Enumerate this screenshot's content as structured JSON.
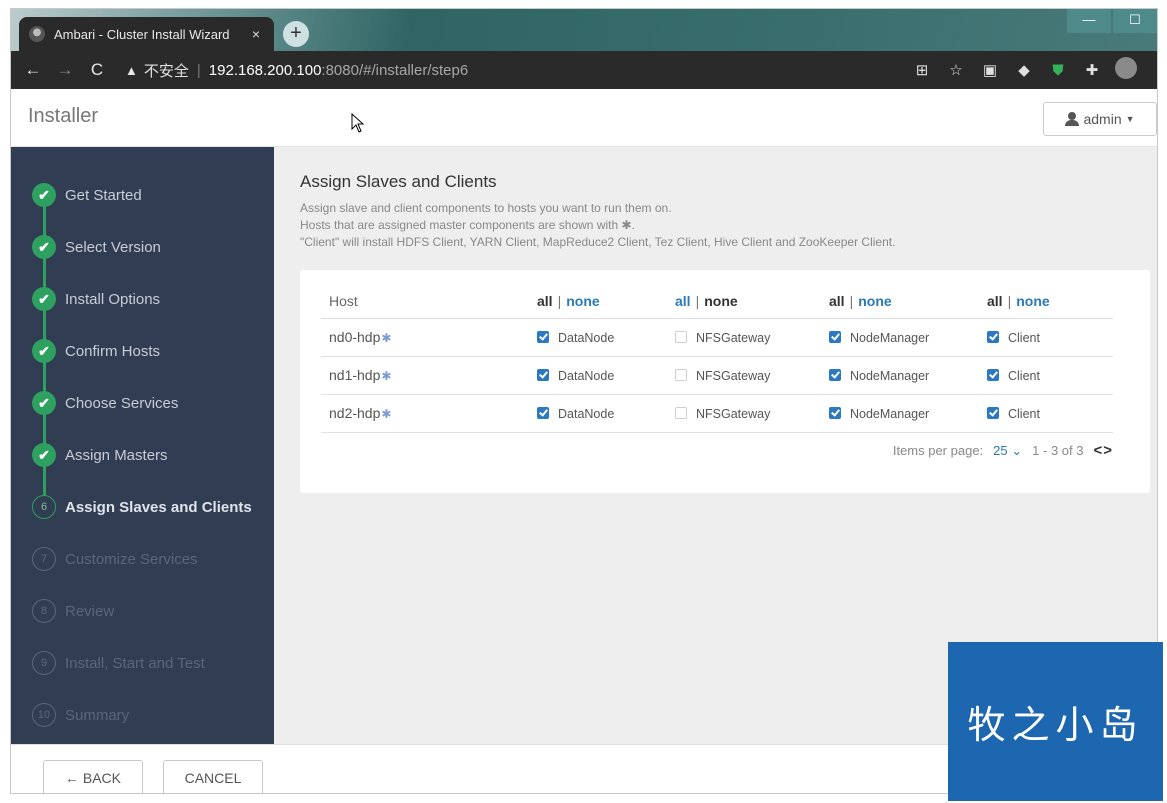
{
  "browser": {
    "tab_title": "Ambari - Cluster Install Wizard",
    "tab_close": "×",
    "new_tab": "+",
    "window_controls": [
      "—",
      "☐"
    ],
    "back": "←",
    "forward": "→",
    "reload": "C",
    "warning_icon": "▲",
    "security_label": "不安全",
    "separator": "|",
    "url_host": "192.168.200.100",
    "url_path": ":8080/#/installer/step6",
    "extension_icons": [
      "translate-icon",
      "star-icon",
      "media-icon",
      "extension-a-icon",
      "shield-icon",
      "puzzle-icon",
      "profile-icon"
    ]
  },
  "header": {
    "brand": "Installer",
    "user": "admin"
  },
  "sidebar": {
    "steps": [
      {
        "label": "Get Started",
        "state": "done",
        "num": "✔"
      },
      {
        "label": "Select Version",
        "state": "done",
        "num": "✔"
      },
      {
        "label": "Install Options",
        "state": "done",
        "num": "✔"
      },
      {
        "label": "Confirm Hosts",
        "state": "done",
        "num": "✔"
      },
      {
        "label": "Choose Services",
        "state": "done",
        "num": "✔"
      },
      {
        "label": "Assign Masters",
        "state": "done",
        "num": "✔"
      },
      {
        "label": "Assign Slaves and Clients",
        "state": "current",
        "num": "6"
      },
      {
        "label": "Customize Services",
        "state": "todo",
        "num": "7"
      },
      {
        "label": "Review",
        "state": "todo",
        "num": "8"
      },
      {
        "label": "Install, Start and Test",
        "state": "todo",
        "num": "9"
      },
      {
        "label": "Summary",
        "state": "todo",
        "num": "10"
      }
    ]
  },
  "main": {
    "title": "Assign Slaves and Clients",
    "desc1": "Assign slave and client components to hosts you want to run them on.",
    "desc2": "Hosts that are assigned master components are shown with ✱.",
    "desc3": "\"Client\" will install HDFS Client, YARN Client, MapReduce2 Client, Tez Client, Hive Client and ZooKeeper Client.",
    "table": {
      "host_header": "Host",
      "all": "all",
      "none": "none",
      "pipe": "|",
      "rows": [
        {
          "host": "nd0-hdp",
          "datanode": true,
          "nfs": false,
          "nm": true,
          "client": true
        },
        {
          "host": "nd1-hdp",
          "datanode": true,
          "nfs": false,
          "nm": true,
          "client": true
        },
        {
          "host": "nd2-hdp",
          "datanode": true,
          "nfs": false,
          "nm": true,
          "client": true
        }
      ],
      "components": [
        "DataNode",
        "NFSGateway",
        "NodeManager",
        "Client"
      ],
      "star": "✱"
    },
    "pager": {
      "label": "Items per page:",
      "per_page": "25",
      "chevron": "⌄",
      "range": "1 - 3 of 3",
      "arrows": "<>"
    }
  },
  "footer": {
    "back": "← BACK",
    "cancel": "CANCEL"
  },
  "watermark": "牧之小岛",
  "colors": {
    "sidebar_bg": "#313d53",
    "done_green": "#2ea05f",
    "link_blue": "#2a7ab8",
    "checkbox_blue": "#2b79c2",
    "watermark_blue": "#1d66b0"
  }
}
